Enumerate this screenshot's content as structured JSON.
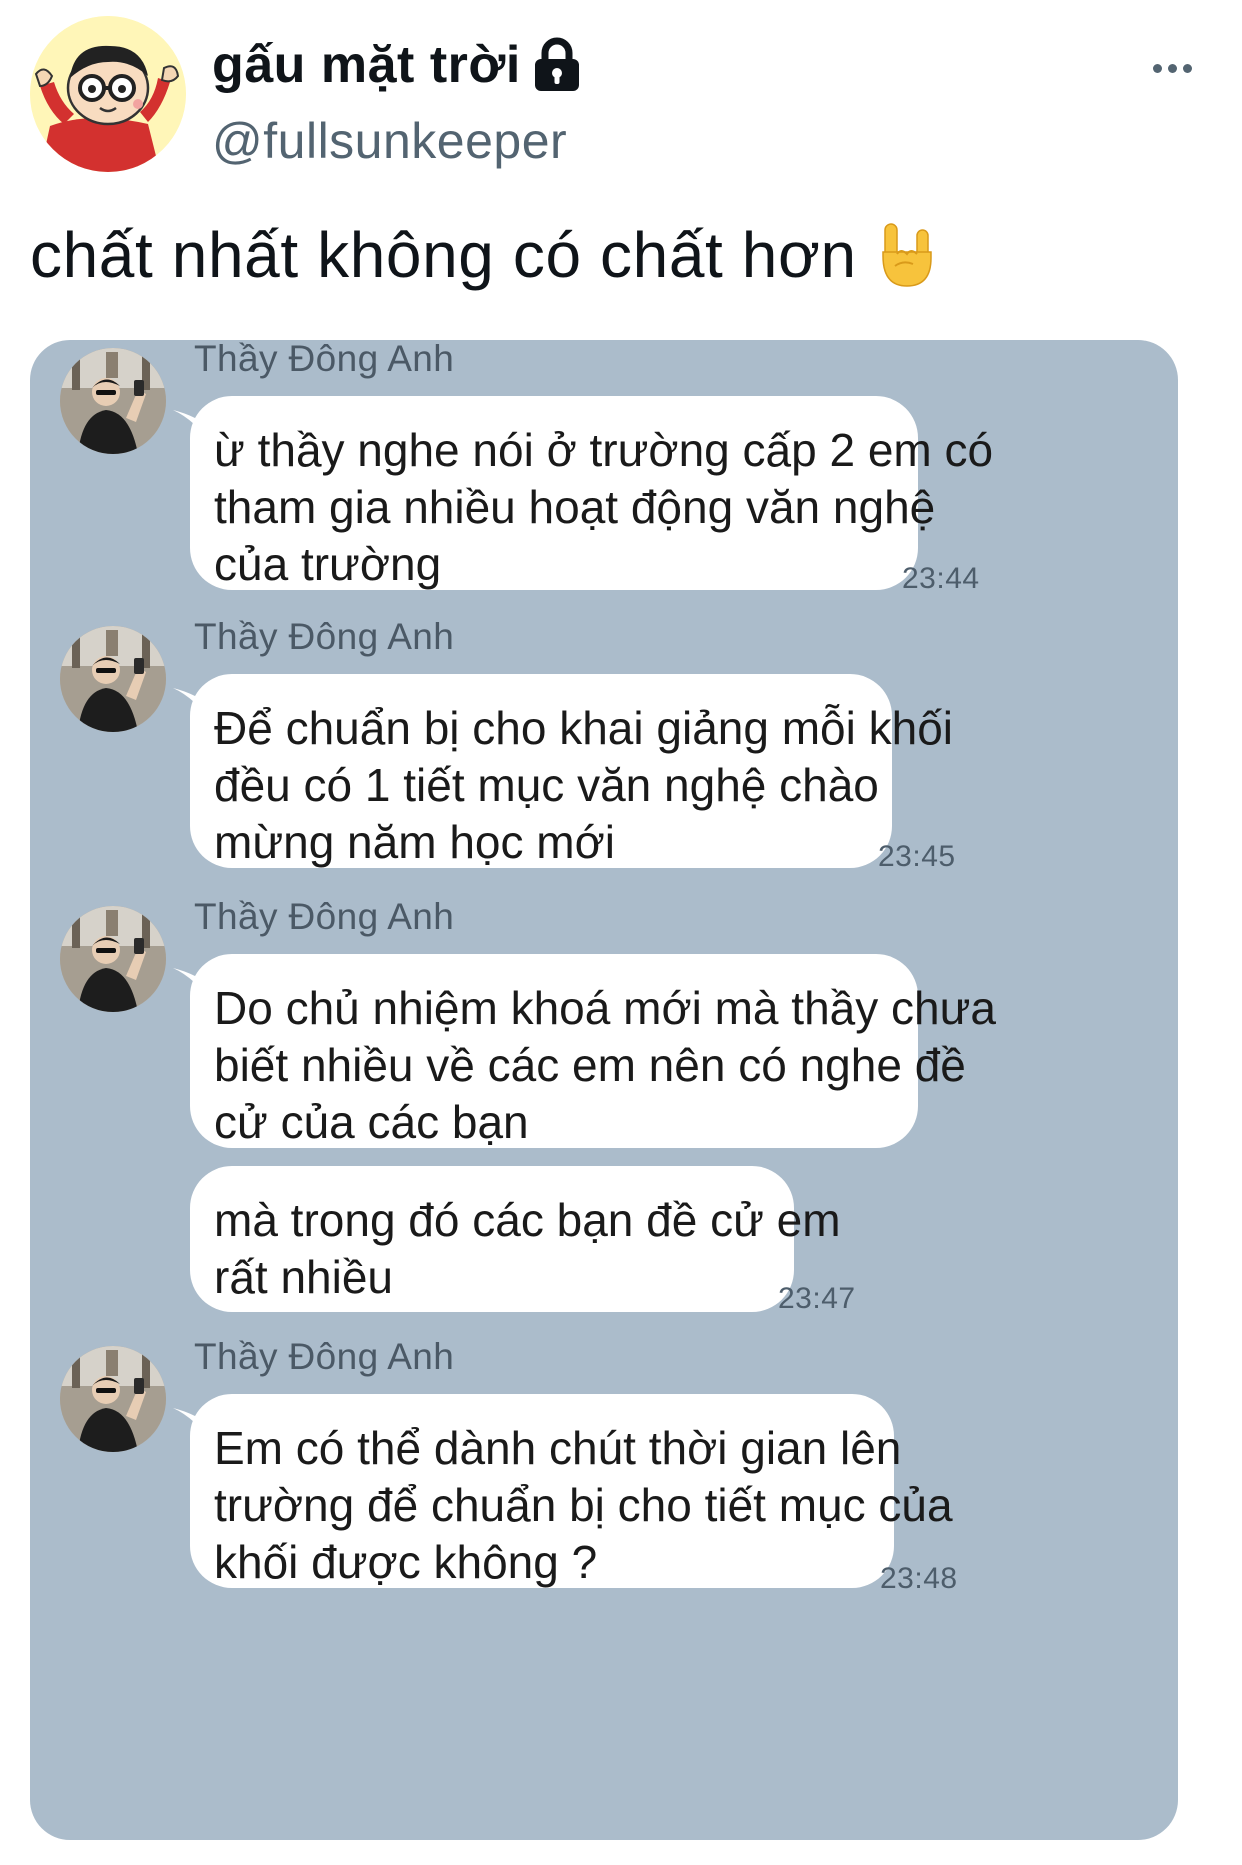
{
  "tweet": {
    "display_name": "gấu mặt trời",
    "handle": "@fullsunkeeper",
    "text": "chất nhất không có chất hơn",
    "emoji_icon": "sign-of-the-horns-emoji"
  },
  "icons": {
    "lock": "lock-icon",
    "more": "more-horizontal-icon"
  },
  "chat": {
    "background_color": "#abbccb",
    "messages": [
      {
        "sender": "Thầy Đông Anh",
        "lines": [
          "ừ thầy nghe nói ở trường cấp 2 em có",
          "tham gia nhiều hoạt động văn nghệ",
          "của trường"
        ],
        "time": "23:44"
      },
      {
        "sender": "Thầy Đông Anh",
        "lines": [
          "Để chuẩn bị cho khai giảng mỗi khối",
          "đều có 1 tiết mục văn nghệ chào",
          "mừng năm học mới"
        ],
        "time": "23:45"
      },
      {
        "sender": "Thầy Đông Anh",
        "lines": [
          "Do chủ nhiệm khoá mới mà thầy chưa",
          "biết nhiều về các em nên có nghe đề",
          "cử của các bạn"
        ],
        "time": ""
      },
      {
        "sender": "",
        "lines": [
          "mà trong đó các bạn đề cử em",
          "rất nhiều"
        ],
        "time": "23:47"
      },
      {
        "sender": "Thầy Đông Anh",
        "lines": [
          "Em có thể dành chút thời gian lên",
          "trường để chuẩn bị cho tiết mục của",
          "khối được không ?"
        ],
        "time": "23:48"
      }
    ]
  }
}
